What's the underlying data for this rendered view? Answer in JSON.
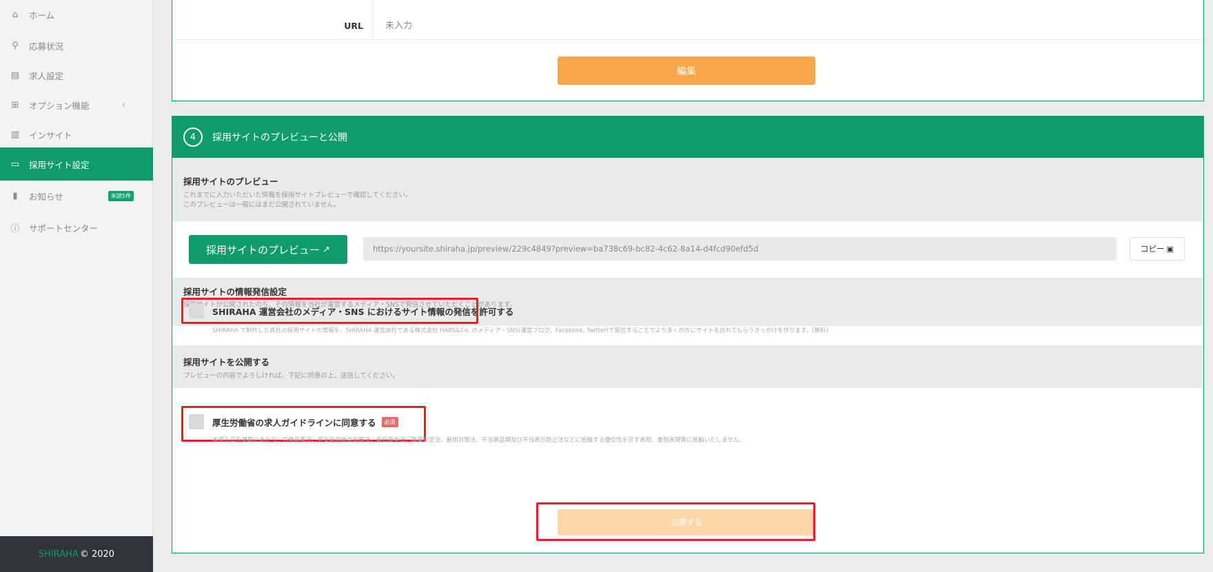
{
  "sidebar": {
    "items": [
      {
        "icon": "home-icon",
        "label": "ホーム"
      },
      {
        "icon": "user-search-icon",
        "label": "応募状況"
      },
      {
        "icon": "id-card-icon",
        "label": "求人設定"
      },
      {
        "icon": "plus-box-icon",
        "label": "オプション機能",
        "chevron": "‹"
      },
      {
        "icon": "bar-chart-icon",
        "label": "インサイト"
      },
      {
        "icon": "monitor-icon",
        "label": "採用サイト設定"
      },
      {
        "icon": "document-icon",
        "label": "お知らせ",
        "badge": "未読5件"
      },
      {
        "icon": "help-circle-icon",
        "label": "サポートセンター"
      }
    ],
    "active_index": 5,
    "footer": {
      "brand": "SHIRAHA",
      "copyright": "© 2020"
    }
  },
  "top_card": {
    "url_label": "URL",
    "url_value": "未入力",
    "edit_button": "編集"
  },
  "section4": {
    "number": "4",
    "title": "採用サイトのプレビューと公開",
    "preview": {
      "heading": "採用サイトのプレビュー",
      "desc_line1": "これまでに入力いただいた情報を採用サイトプレビューで確認してください。",
      "desc_line2": "このプレビューは一般にはまだ公開されていません。",
      "button": "採用サイトのプレビュー",
      "url": "https://yoursite.shiraha.jp/preview/229c4849?preview=ba738c69-bc82-4c62-8a14-d4fcd90efd5d",
      "copy_button": "コピー"
    },
    "info_setting": {
      "heading": "採用サイトの情報発信設定",
      "desc": "採用サイトが公開されたのち、その情報を当社が運営するメディア・SNSで発信させていただくことがあります。",
      "checkbox_label": "SHIRAHA 運営会社のメディア・SNS におけるサイト情報の発信を許可する",
      "note": "SHIRAHA で制作した貴社の採用サイトの情報を、SHIRAHA 運営会社である株式会社 HABS&Co. のメディア・SNS(運営ブログ、Facebook, Twitter)で発信することでより多くの方にサイトを訪れてもらうきっかけを作ります。(無料)"
    },
    "publish": {
      "heading": "採用サイトを公開する",
      "desc": "プレビューの内容でよろしければ、下記に同意の上、送信してください。",
      "checkbox_label": "厚生労働省の求人ガイドラインに同意する",
      "required_badge": "必須",
      "note": "本求人広告掲載にあたり、労働基準法、男女雇用機会均等法、最低賃金法、職業安定法、雇用対策法、不当景品類及び不当表示防止法などに抵触する優位性を示す表現、差別表現等に抵触いたしません。",
      "button": "公開する"
    }
  },
  "colors": {
    "primary_green": "#0f9b6e",
    "orange": "#f5a54a",
    "orange_disabled": "#fcd7a7",
    "highlight_red": "#e8202a"
  }
}
